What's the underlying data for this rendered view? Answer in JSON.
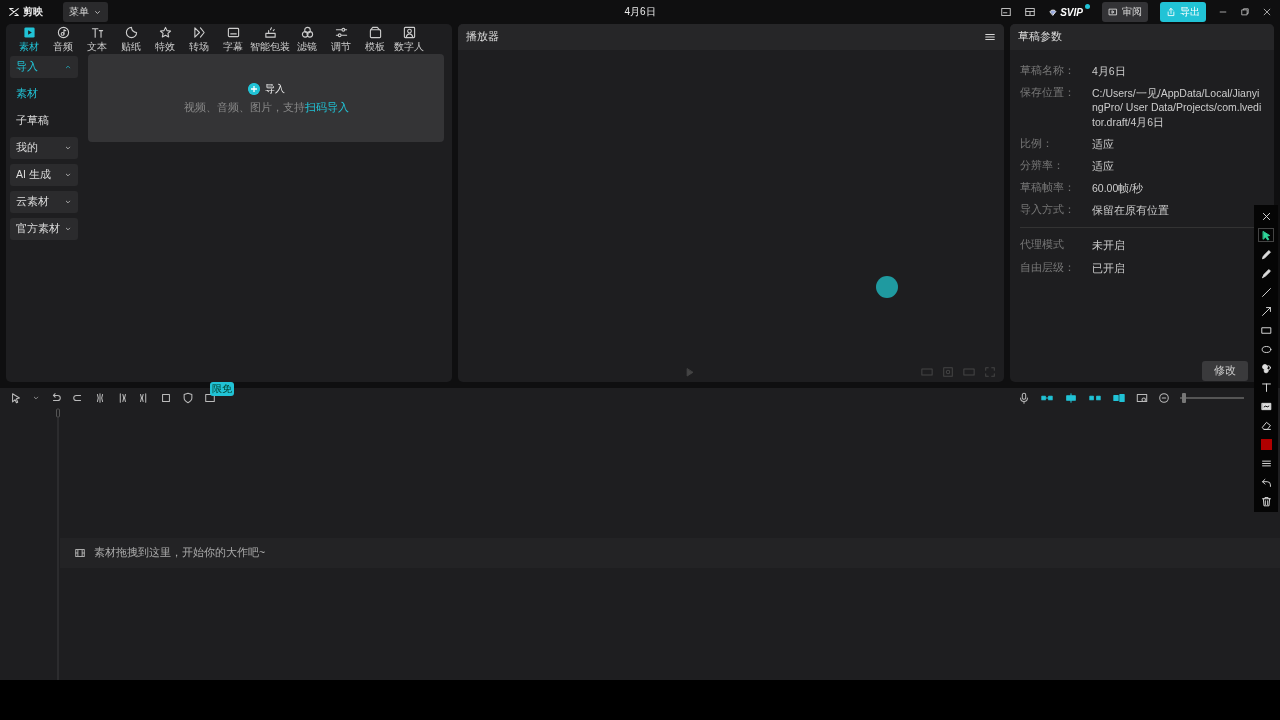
{
  "app": {
    "name": "剪映",
    "menu": "菜单"
  },
  "title": "4月6日",
  "top_actions": {
    "badge": "SVIP",
    "review": "审阅",
    "export": "导出"
  },
  "tabs": [
    {
      "label": "素材",
      "selected": true
    },
    {
      "label": "音频",
      "selected": false
    },
    {
      "label": "文本",
      "selected": false
    },
    {
      "label": "贴纸",
      "selected": false
    },
    {
      "label": "特效",
      "selected": false
    },
    {
      "label": "转场",
      "selected": false
    },
    {
      "label": "字幕",
      "selected": false
    },
    {
      "label": "智能包装",
      "selected": false
    },
    {
      "label": "滤镜",
      "selected": false
    },
    {
      "label": "调节",
      "selected": false
    },
    {
      "label": "模板",
      "selected": false
    },
    {
      "label": "数字人",
      "selected": false
    }
  ],
  "sidebar": [
    {
      "kind": "group",
      "label": "导入",
      "expanded": true
    },
    {
      "kind": "item",
      "label": "素材",
      "selected": true
    },
    {
      "kind": "item",
      "label": "子草稿",
      "selected": false
    },
    {
      "kind": "group",
      "label": "我的",
      "expanded": false
    },
    {
      "kind": "group",
      "label": "AI 生成",
      "expanded": false
    },
    {
      "kind": "group",
      "label": "云素材",
      "expanded": false
    },
    {
      "kind": "group",
      "label": "官方素材",
      "expanded": false
    }
  ],
  "import_area": {
    "button": "导入",
    "hint": "视频、音频、图片，支持",
    "link": "扫码导入"
  },
  "player": {
    "title": "播放器"
  },
  "draft": {
    "title": "草稿参数",
    "groups": [
      [
        {
          "label": "草稿名称：",
          "value": "4月6日"
        },
        {
          "label": "保存位置：",
          "value": "C:/Users/一见/AppData/Local/JianyingPro/ User Data/Projects/com.lveditor.draft/4月6日"
        },
        {
          "label": "比例：",
          "value": "适应"
        },
        {
          "label": "分辨率：",
          "value": "适应"
        },
        {
          "label": "草稿帧率：",
          "value": "60.00帧/秒"
        },
        {
          "label": "导入方式：",
          "value": "保留在原有位置"
        }
      ],
      [
        {
          "label": "代理模式",
          "value": "未开启"
        },
        {
          "label": "自由层级：",
          "value": "已开启"
        }
      ]
    ],
    "edit_button": "修改"
  },
  "timeline": {
    "badge": "限免",
    "zoom": {
      "level": 0.03
    },
    "hint": "素材拖拽到这里，开始你的大作吧~"
  },
  "annotation_tools": [
    {
      "selected": false
    },
    {
      "selected": true
    },
    {
      "selected": false
    },
    {
      "selected": false
    },
    {
      "selected": false
    },
    {
      "selected": false
    },
    {
      "selected": false
    },
    {
      "selected": false
    },
    {
      "selected": false
    },
    {
      "selected": false
    },
    {
      "selected": false
    },
    {
      "selected": false
    },
    {
      "color": "#b00000"
    },
    {
      "selected": false
    },
    {
      "selected": false
    },
    {
      "selected": false
    }
  ]
}
